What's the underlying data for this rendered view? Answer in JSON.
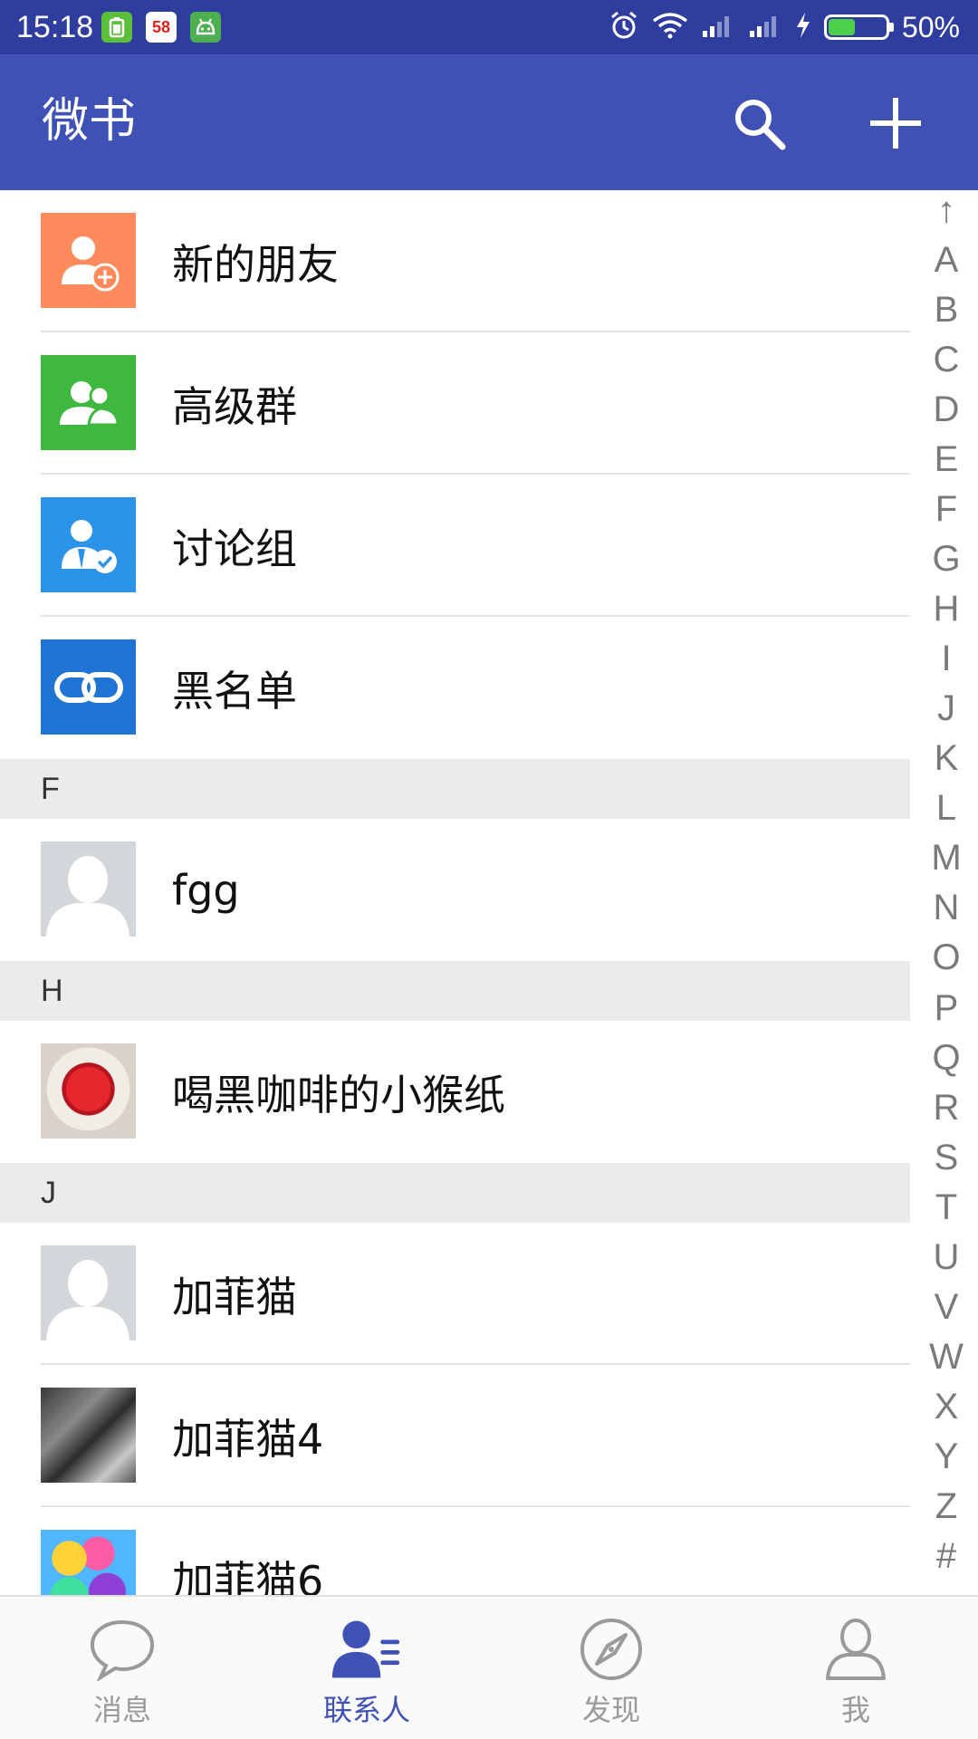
{
  "status_bar": {
    "time": "15:18",
    "apps": [
      "battery-app-icon",
      "58",
      "android-icon"
    ],
    "battery_percent": "50%",
    "battery_level": 0.5
  },
  "app_bar": {
    "title": "微书",
    "actions": [
      "search-icon",
      "plus-icon"
    ]
  },
  "colors": {
    "primary": "#3f51b5",
    "status_bar": "#2f3e9e",
    "active_tab": "#3f51b5",
    "inactive_tab": "#9a9a9a"
  },
  "fixed_entries": [
    {
      "label": "新的朋友",
      "icon": "add-friend-icon",
      "color": "#ff8a5b"
    },
    {
      "label": "高级群",
      "icon": "group-icon",
      "color": "#3fb83f"
    },
    {
      "label": "讨论组",
      "icon": "discussion-icon",
      "color": "#2b93e8"
    },
    {
      "label": "黑名单",
      "icon": "link-icon",
      "color": "#1f74d4"
    }
  ],
  "sections": [
    {
      "header": "F",
      "contacts": [
        {
          "name": "fgg",
          "avatar": "default-avatar"
        }
      ]
    },
    {
      "header": "H",
      "contacts": [
        {
          "name": "喝黑咖啡的小猴纸",
          "avatar": "cake-photo"
        }
      ]
    },
    {
      "header": "J",
      "contacts": [
        {
          "name": "加菲猫",
          "avatar": "default-avatar"
        },
        {
          "name": "加菲猫4",
          "avatar": "person-photo"
        },
        {
          "name": "加菲猫6",
          "avatar": "balloons-photo"
        }
      ]
    }
  ],
  "alphabet_index": [
    "↑",
    "A",
    "B",
    "C",
    "D",
    "E",
    "F",
    "G",
    "H",
    "I",
    "J",
    "K",
    "L",
    "M",
    "N",
    "O",
    "P",
    "Q",
    "R",
    "S",
    "T",
    "U",
    "V",
    "W",
    "X",
    "Y",
    "Z",
    "#"
  ],
  "tabs": [
    {
      "label": "消息",
      "icon": "chat-bubble-icon",
      "active": false
    },
    {
      "label": "联系人",
      "icon": "contacts-icon",
      "active": true
    },
    {
      "label": "发现",
      "icon": "compass-icon",
      "active": false
    },
    {
      "label": "我",
      "icon": "person-icon",
      "active": false
    }
  ]
}
